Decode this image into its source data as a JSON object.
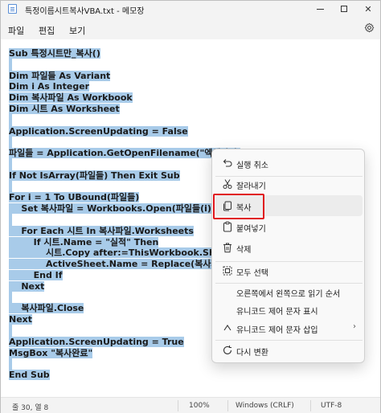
{
  "window": {
    "title": "특정이름시트복사VBA.txt - 메모장"
  },
  "menu": {
    "file": "파일",
    "edit": "편집",
    "view": "보기"
  },
  "editor": {
    "lines": [
      "Sub 특정시트만_복사()",
      "",
      "Dim 파일들 As Variant",
      "Dim i As Integer",
      "Dim 복사파일 As Workbook",
      "Dim 시트 As Worksheet",
      "",
      "Application.ScreenUpdating = False",
      "",
      "파일들 = Application.GetOpenFilename(\"엑셀파일,",
      "",
      "If Not IsArray(파일들) Then Exit Sub",
      "",
      "For i = 1 To UBound(파일들)",
      "    Set 복사파일 = Workbooks.Open(파일들(i), Rea",
      "",
      "    For Each 시트 In 복사파일.Worksheets",
      "        If 시트.Name = \"실적\" Then",
      "            시트.Copy after:=ThisWorkbook.Sheets(T",
      "            ActiveSheet.Name = Replace(복사파일.N",
      "        End If",
      "    Next",
      "",
      "    복사파일.Close",
      "Next",
      "",
      "Application.ScreenUpdating = True",
      "MsgBox \"복사완료\"",
      "",
      "End Sub"
    ]
  },
  "status": {
    "position": "줄 30, 열 8",
    "zoom": "100%",
    "line_ending": "Windows (CRLF)",
    "encoding": "UTF-8"
  },
  "context_menu": {
    "undo": "실행 취소",
    "cut": "잘라내기",
    "copy": "복사",
    "paste": "붙여넣기",
    "delete": "삭제",
    "select_all": "모두 선택",
    "rtl": "오른쪽에서 왼쪽으로 읽기 순서",
    "show_unicode": "유니코드 제어 문자 표시",
    "insert_unicode": "유니코드 제어 문자 삽입",
    "reconvert": "다시 변환"
  },
  "colors": {
    "selection": "#a8cbe9",
    "highlight_box": "#e0161c",
    "chrome": "#f3f3f3"
  }
}
